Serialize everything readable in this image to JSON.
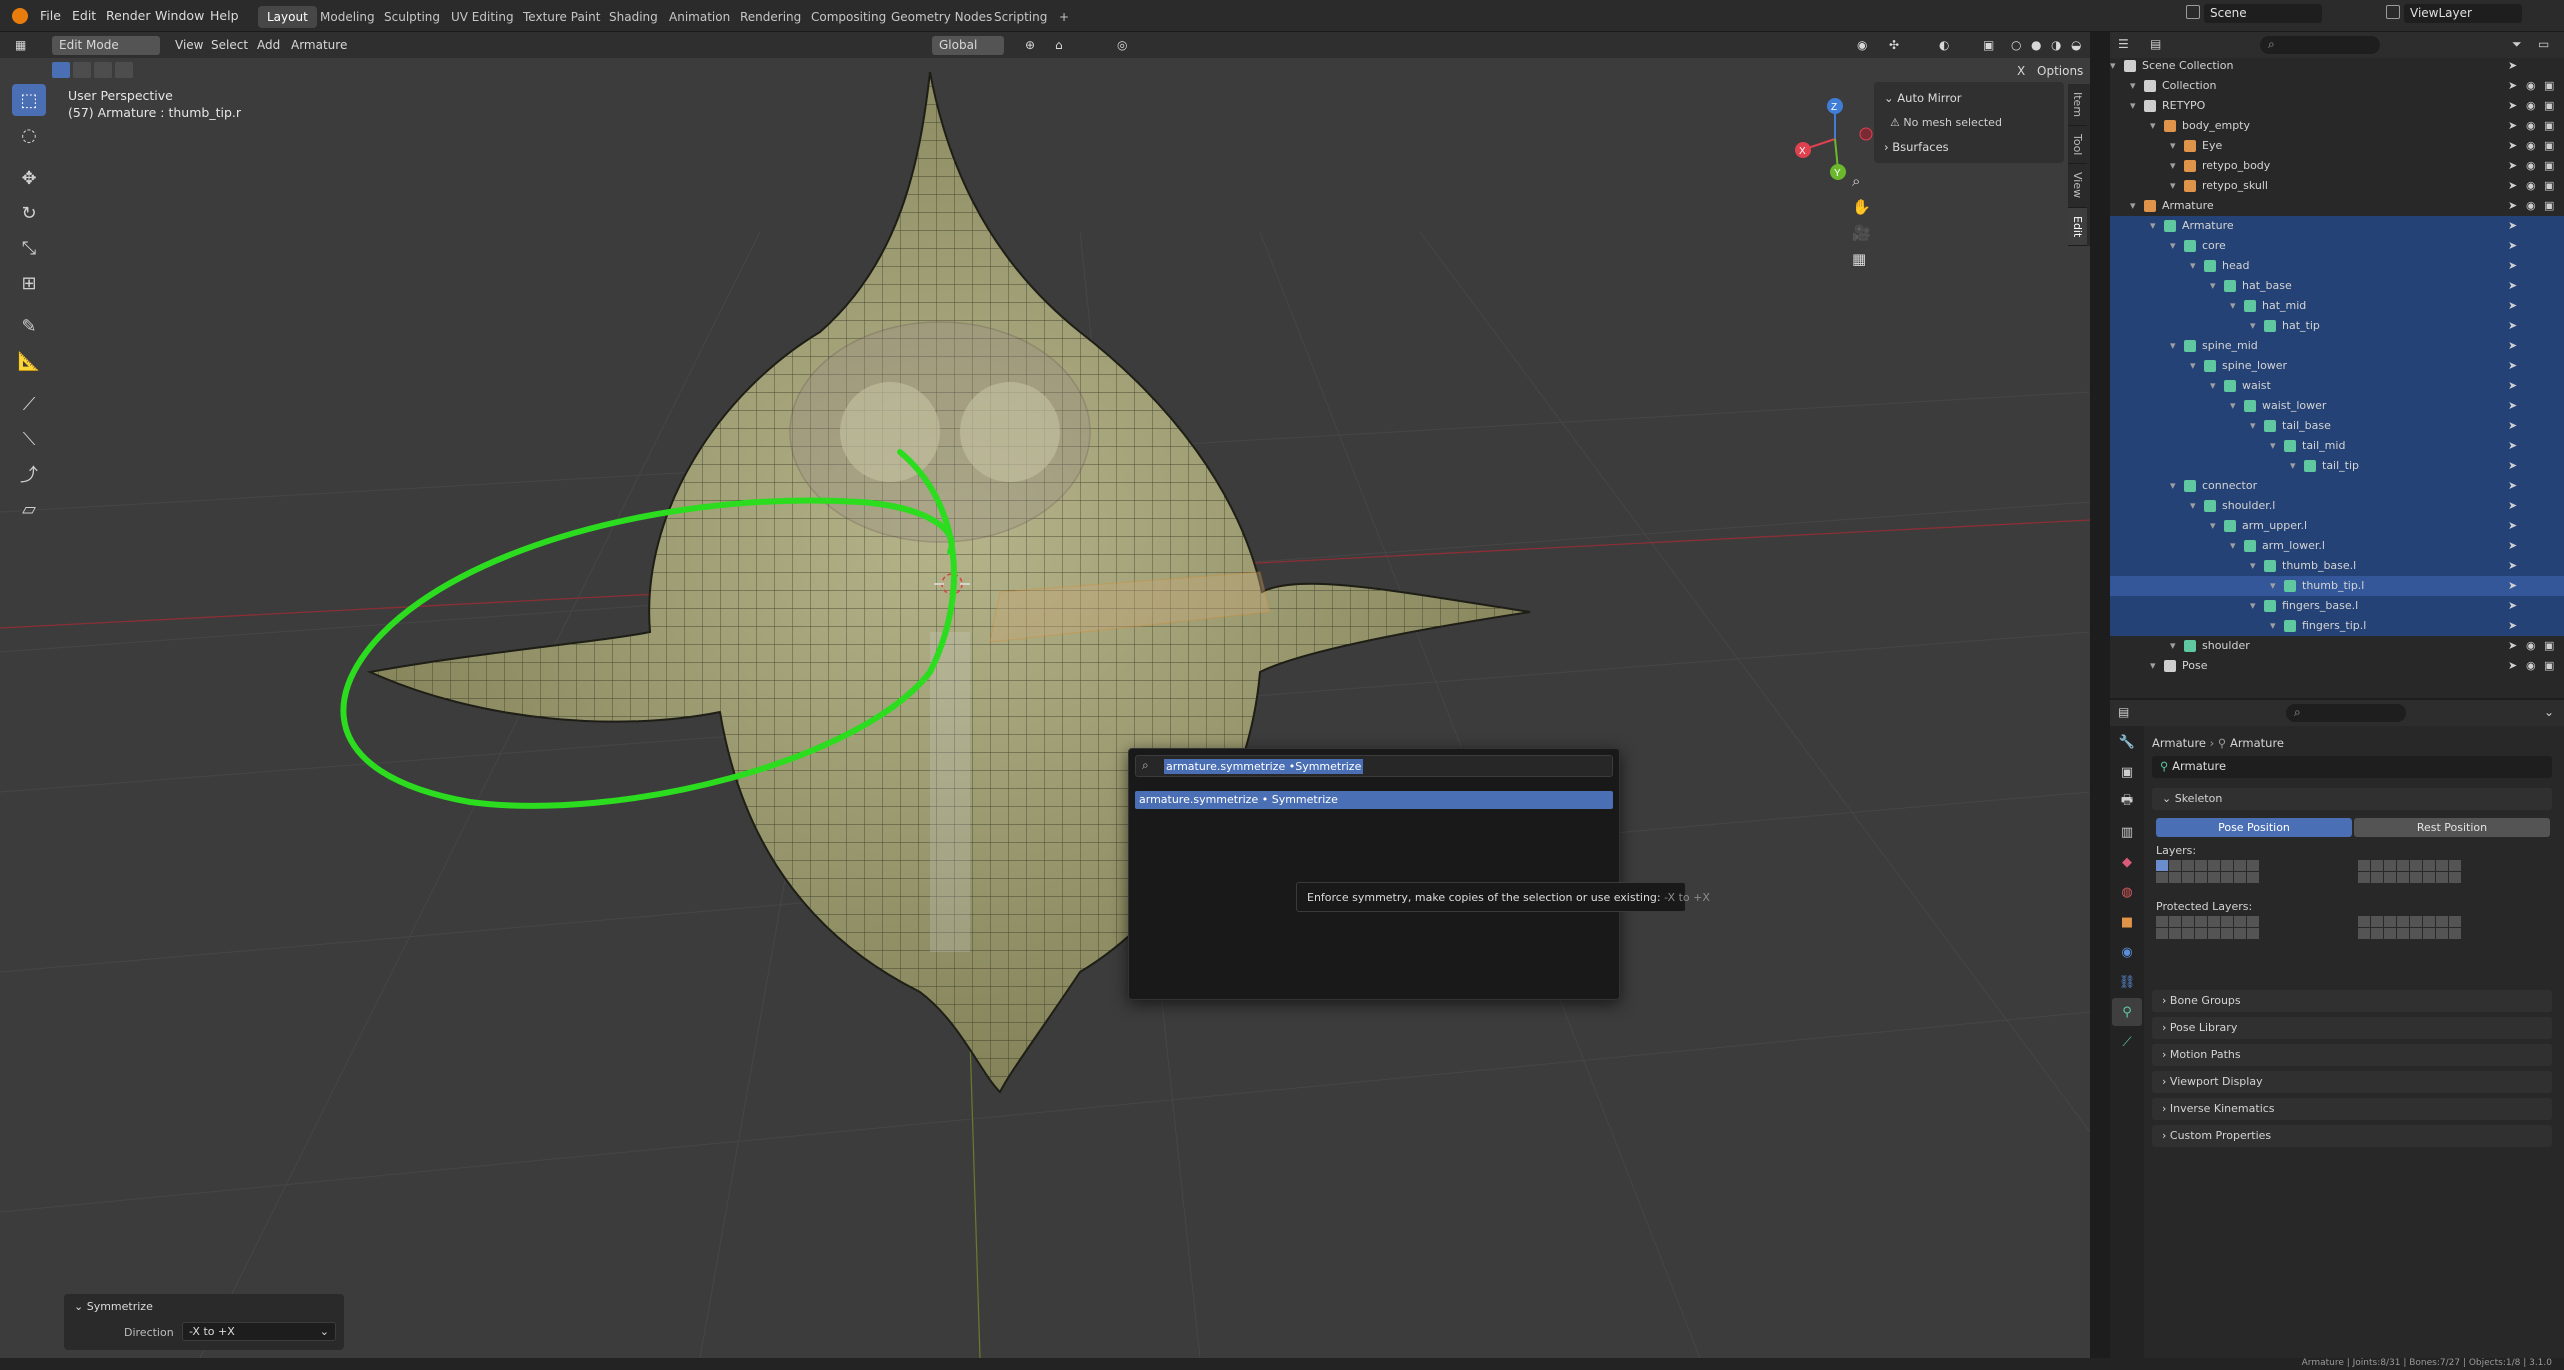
{
  "topbar": {
    "menus": [
      "File",
      "Edit",
      "Render",
      "Window",
      "Help"
    ],
    "workspaces": [
      "Layout",
      "Modeling",
      "Sculpting",
      "UV Editing",
      "Texture Paint",
      "Shading",
      "Animation",
      "Rendering",
      "Compositing",
      "Geometry Nodes",
      "Scripting"
    ],
    "active_workspace": "Layout",
    "add_tab": "+",
    "scene_name": "Scene",
    "view_layer": "ViewLayer"
  },
  "viewport": {
    "mode": "Edit Mode",
    "menus": [
      "View",
      "Select",
      "Add",
      "Armature"
    ],
    "transform_orientation": "Global",
    "options_label": "Options",
    "close_x": "X",
    "perspective_label": "User Perspective",
    "object_label": "(57) Armature : thumb_tip.r",
    "gizmo_axes": {
      "x": "X",
      "y": "Y",
      "z": "Z"
    },
    "side_tabs": [
      "Item",
      "Tool",
      "View",
      "Edit"
    ],
    "npanel": {
      "auto_mirror_title": "Auto Mirror",
      "auto_mirror_msg": "No mesh selected",
      "bsurfaces_title": "Bsurfaces"
    }
  },
  "search": {
    "query": "armature.symmetrize •Symmetrize",
    "result": "armature.symmetrize •  Symmetrize",
    "tooltip": "Enforce symmetry, make copies of the selection or use existing:",
    "tooltip_hint": "-X to +X"
  },
  "redo_panel": {
    "title": "Symmetrize",
    "direction_label": "Direction",
    "direction_value": "-X to +X"
  },
  "outliner": {
    "rows": [
      {
        "label": "Scene Collection",
        "indent": 0,
        "icon": "scene-collection-icon",
        "color": "#cfcfcf"
      },
      {
        "label": "Collection",
        "indent": 1,
        "icon": "collection-icon",
        "color": "#cfcfcf"
      },
      {
        "label": "RETYPO",
        "indent": 1,
        "icon": "collection-icon",
        "color": "#cfcfcf"
      },
      {
        "label": "body_empty",
        "indent": 2,
        "icon": "empty-icon",
        "color": "#e0944a"
      },
      {
        "label": "Eye",
        "indent": 3,
        "icon": "mesh-icon",
        "color": "#e0944a"
      },
      {
        "label": "retypo_body",
        "indent": 3,
        "icon": "mesh-icon",
        "color": "#e0944a"
      },
      {
        "label": "retypo_skull",
        "indent": 3,
        "icon": "mesh-icon",
        "color": "#e0944a"
      },
      {
        "label": "Armature",
        "indent": 1,
        "icon": "armature-icon",
        "color": "#e0944a"
      },
      {
        "label": "Armature",
        "indent": 2,
        "icon": "armature-data-icon",
        "color": "#5fc8a0",
        "sel": true
      },
      {
        "label": "core",
        "indent": 3,
        "icon": "bone-icon",
        "color": "#5fc8a0",
        "sel": true
      },
      {
        "label": "head",
        "indent": 4,
        "icon": "bone-icon",
        "color": "#5fc8a0",
        "sel": true
      },
      {
        "label": "hat_base",
        "indent": 5,
        "icon": "bone-icon",
        "color": "#5fc8a0",
        "sel": true
      },
      {
        "label": "hat_mid",
        "indent": 6,
        "icon": "bone-icon",
        "color": "#5fc8a0",
        "sel": true
      },
      {
        "label": "hat_tip",
        "indent": 7,
        "icon": "bone-icon",
        "color": "#5fc8a0",
        "sel": true
      },
      {
        "label": "spine_mid",
        "indent": 3,
        "icon": "bone-icon",
        "color": "#5fc8a0",
        "sel": true
      },
      {
        "label": "spine_lower",
        "indent": 4,
        "icon": "bone-icon",
        "color": "#5fc8a0",
        "sel": true
      },
      {
        "label": "waist",
        "indent": 5,
        "icon": "bone-icon",
        "color": "#5fc8a0",
        "sel": true
      },
      {
        "label": "waist_lower",
        "indent": 6,
        "icon": "bone-icon",
        "color": "#5fc8a0",
        "sel": true
      },
      {
        "label": "tail_base",
        "indent": 7,
        "icon": "bone-icon",
        "color": "#5fc8a0",
        "sel": true
      },
      {
        "label": "tail_mid",
        "indent": 8,
        "icon": "bone-icon",
        "color": "#5fc8a0",
        "sel": true
      },
      {
        "label": "tail_tip",
        "indent": 9,
        "icon": "bone-icon",
        "color": "#5fc8a0",
        "sel": true
      },
      {
        "label": "connector",
        "indent": 3,
        "icon": "bone-icon",
        "color": "#5fc8a0",
        "sel": true
      },
      {
        "label": "shoulder.l",
        "indent": 4,
        "icon": "bone-icon",
        "color": "#5fc8a0",
        "sel": true
      },
      {
        "label": "arm_upper.l",
        "indent": 5,
        "icon": "bone-icon",
        "color": "#5fc8a0",
        "sel": true
      },
      {
        "label": "arm_lower.l",
        "indent": 6,
        "icon": "bone-icon",
        "color": "#5fc8a0",
        "sel": true
      },
      {
        "label": "thumb_base.l",
        "indent": 7,
        "icon": "bone-icon",
        "color": "#5fc8a0",
        "sel": true
      },
      {
        "label": "thumb_tip.l",
        "indent": 8,
        "icon": "bone-icon",
        "color": "#5fc8a0",
        "active": true
      },
      {
        "label": "fingers_base.l",
        "indent": 7,
        "icon": "bone-icon",
        "color": "#5fc8a0",
        "sel": true
      },
      {
        "label": "fingers_tip.l",
        "indent": 8,
        "icon": "bone-icon",
        "color": "#5fc8a0",
        "sel": true
      },
      {
        "label": "shoulder",
        "indent": 3,
        "icon": "bone-group-icon",
        "color": "#5fc8a0"
      },
      {
        "label": "Pose",
        "indent": 2,
        "icon": "pose-icon",
        "color": "#cfcfcf"
      }
    ]
  },
  "properties": {
    "breadcrumb": [
      "Armature",
      "Armature"
    ],
    "data_name": "Armature",
    "skeleton_title": "Skeleton",
    "pose_position": "Pose Position",
    "rest_position": "Rest Position",
    "layers_label": "Layers:",
    "protected_layers_label": "Protected Layers:",
    "panels": [
      "Bone Groups",
      "Pose Library",
      "Motion Paths",
      "Viewport Display",
      "Inverse Kinematics",
      "Custom Properties"
    ]
  },
  "statusbar": {
    "stats": "Armature | Joints:8/31 | Bones:7/27 | Objects:1/8 | 3.1.0"
  }
}
